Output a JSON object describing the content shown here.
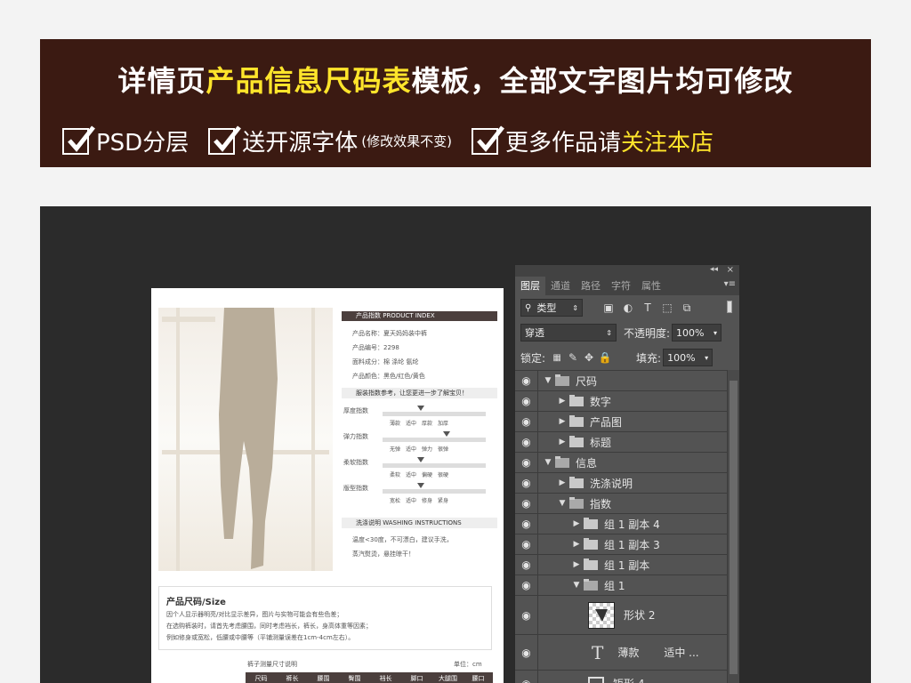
{
  "banner": {
    "title_pre": "详情页",
    "title_hl": "产品信息尺码表",
    "title_post": "模板，全部文字图片均可修改",
    "feature1": "PSD分层",
    "feature2": "送开源字体",
    "feature2_note": "(修改效果不变)",
    "feature3_pre": "更多作品请",
    "feature3_hl": "关注本店"
  },
  "doc": {
    "section1": "产品指数 PRODUCT INDEX",
    "name": "产品名称：夏天妈妈装中裤",
    "code": "产品编号：2298",
    "fabric": "面料成分：棉 涤纶 氨纶",
    "color": "产品颜色：黑色/红色/黄色",
    "section2": "服装指数参考，让您更进一步了解宝贝！",
    "idx1": "厚度指数",
    "idx1_opts": "薄款　适中　厚款　加厚",
    "idx2": "弹力指数",
    "idx2_opts": "无弹　适中　弹力　很弹",
    "idx3": "柔软指数",
    "idx3_opts": "柔软　适中　偏硬　很硬",
    "idx4": "版型指数",
    "idx4_opts": "宽松　适中　修身　紧身",
    "section3": "洗涤说明 WASHING INSTRUCTIONS",
    "wash1": "温度<30度，不可漂白，建议手洗，",
    "wash2": "蒸汽熨烫，悬挂晾干！",
    "size_title": "产品尺码/Size",
    "size_l1": "因个人显示器明亮/对比显示差异，图片与实物可能会有些色差；",
    "size_l2": "在选购裤装时，请首先考虑腰围，同时考虑裆长，裤长，身高体重等因素；",
    "size_l3": "例如修身或宽松，低腰或中腰等（平铺测量误差在1cm-4cm左右）。",
    "measure": "裤子测量尺寸说明",
    "unit": "单位：cm",
    "table_headers": [
      "尺码",
      "裤长",
      "腰围",
      "臀围",
      "裆长",
      "脚口",
      "大腿围",
      "腰口"
    ]
  },
  "panel": {
    "tabs": [
      "图层",
      "通道",
      "路径",
      "字符",
      "属性"
    ],
    "filter_label": "类型",
    "blend_mode": "穿透",
    "opacity_label": "不透明度:",
    "opacity_value": "100%",
    "lock_label": "锁定:",
    "fill_label": "填充:",
    "fill_value": "100%",
    "layers": [
      {
        "name": "尺码",
        "indent": 0,
        "open": true,
        "type": "folder"
      },
      {
        "name": "数字",
        "indent": 1,
        "open": false,
        "type": "folder"
      },
      {
        "name": "产品图",
        "indent": 1,
        "open": false,
        "type": "folder"
      },
      {
        "name": "标题",
        "indent": 1,
        "open": false,
        "type": "folder"
      },
      {
        "name": "信息",
        "indent": 0,
        "open": true,
        "type": "folder"
      },
      {
        "name": "洗涤说明",
        "indent": 1,
        "open": false,
        "type": "folder"
      },
      {
        "name": "指数",
        "indent": 1,
        "open": true,
        "type": "folder"
      },
      {
        "name": "组 1 副本 4",
        "indent": 2,
        "open": false,
        "type": "folder"
      },
      {
        "name": "组 1 副本 3",
        "indent": 2,
        "open": false,
        "type": "folder"
      },
      {
        "name": "组 1 副本",
        "indent": 2,
        "open": false,
        "type": "folder"
      },
      {
        "name": "组 1",
        "indent": 2,
        "open": true,
        "type": "folder"
      }
    ],
    "shape_layer": "形状 2",
    "text_layer": "薄款",
    "text_layer_extra": "适中 ...",
    "bottom_layer": "矩形 4"
  }
}
